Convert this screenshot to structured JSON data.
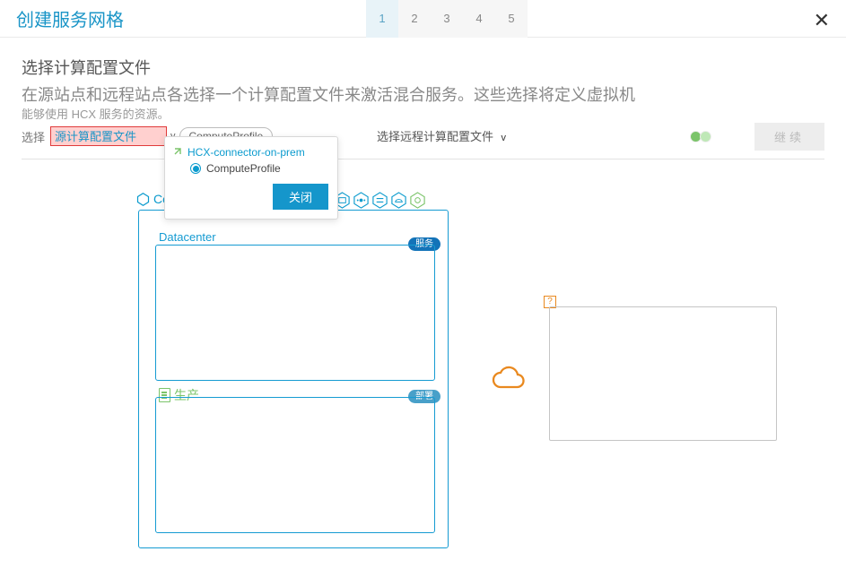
{
  "header": {
    "title": "创建服务网格",
    "steps": [
      "1",
      "2",
      "3",
      "4",
      "5"
    ],
    "active_step": 0,
    "close": "✕"
  },
  "section": {
    "title": "选择计算配置文件",
    "desc_line1": "在源站点和远程站点各选择一个计算配置文件来激活混合服务。这些选择将定义虚拟机",
    "desc_line2": "能够使用 HCX 服务的资源。"
  },
  "source": {
    "label": "选择",
    "highlight_text": "源计算配置文件",
    "dropdown": "v",
    "pill": "ComputeProfile"
  },
  "remote": {
    "label": "选择远程计算配置文件",
    "dropdown": "v"
  },
  "continue_btn": "继续",
  "diagram": {
    "compute_profile": "ComputeProfile",
    "datacenter": "Datacenter",
    "services_badge": "服务",
    "deploy_badge": "部署",
    "prod_label": "生产",
    "q_mark": "?"
  },
  "popup": {
    "site_name": "HCX-connector-on-prem",
    "profile": "ComputeProfile",
    "close_btn": "关闭"
  }
}
